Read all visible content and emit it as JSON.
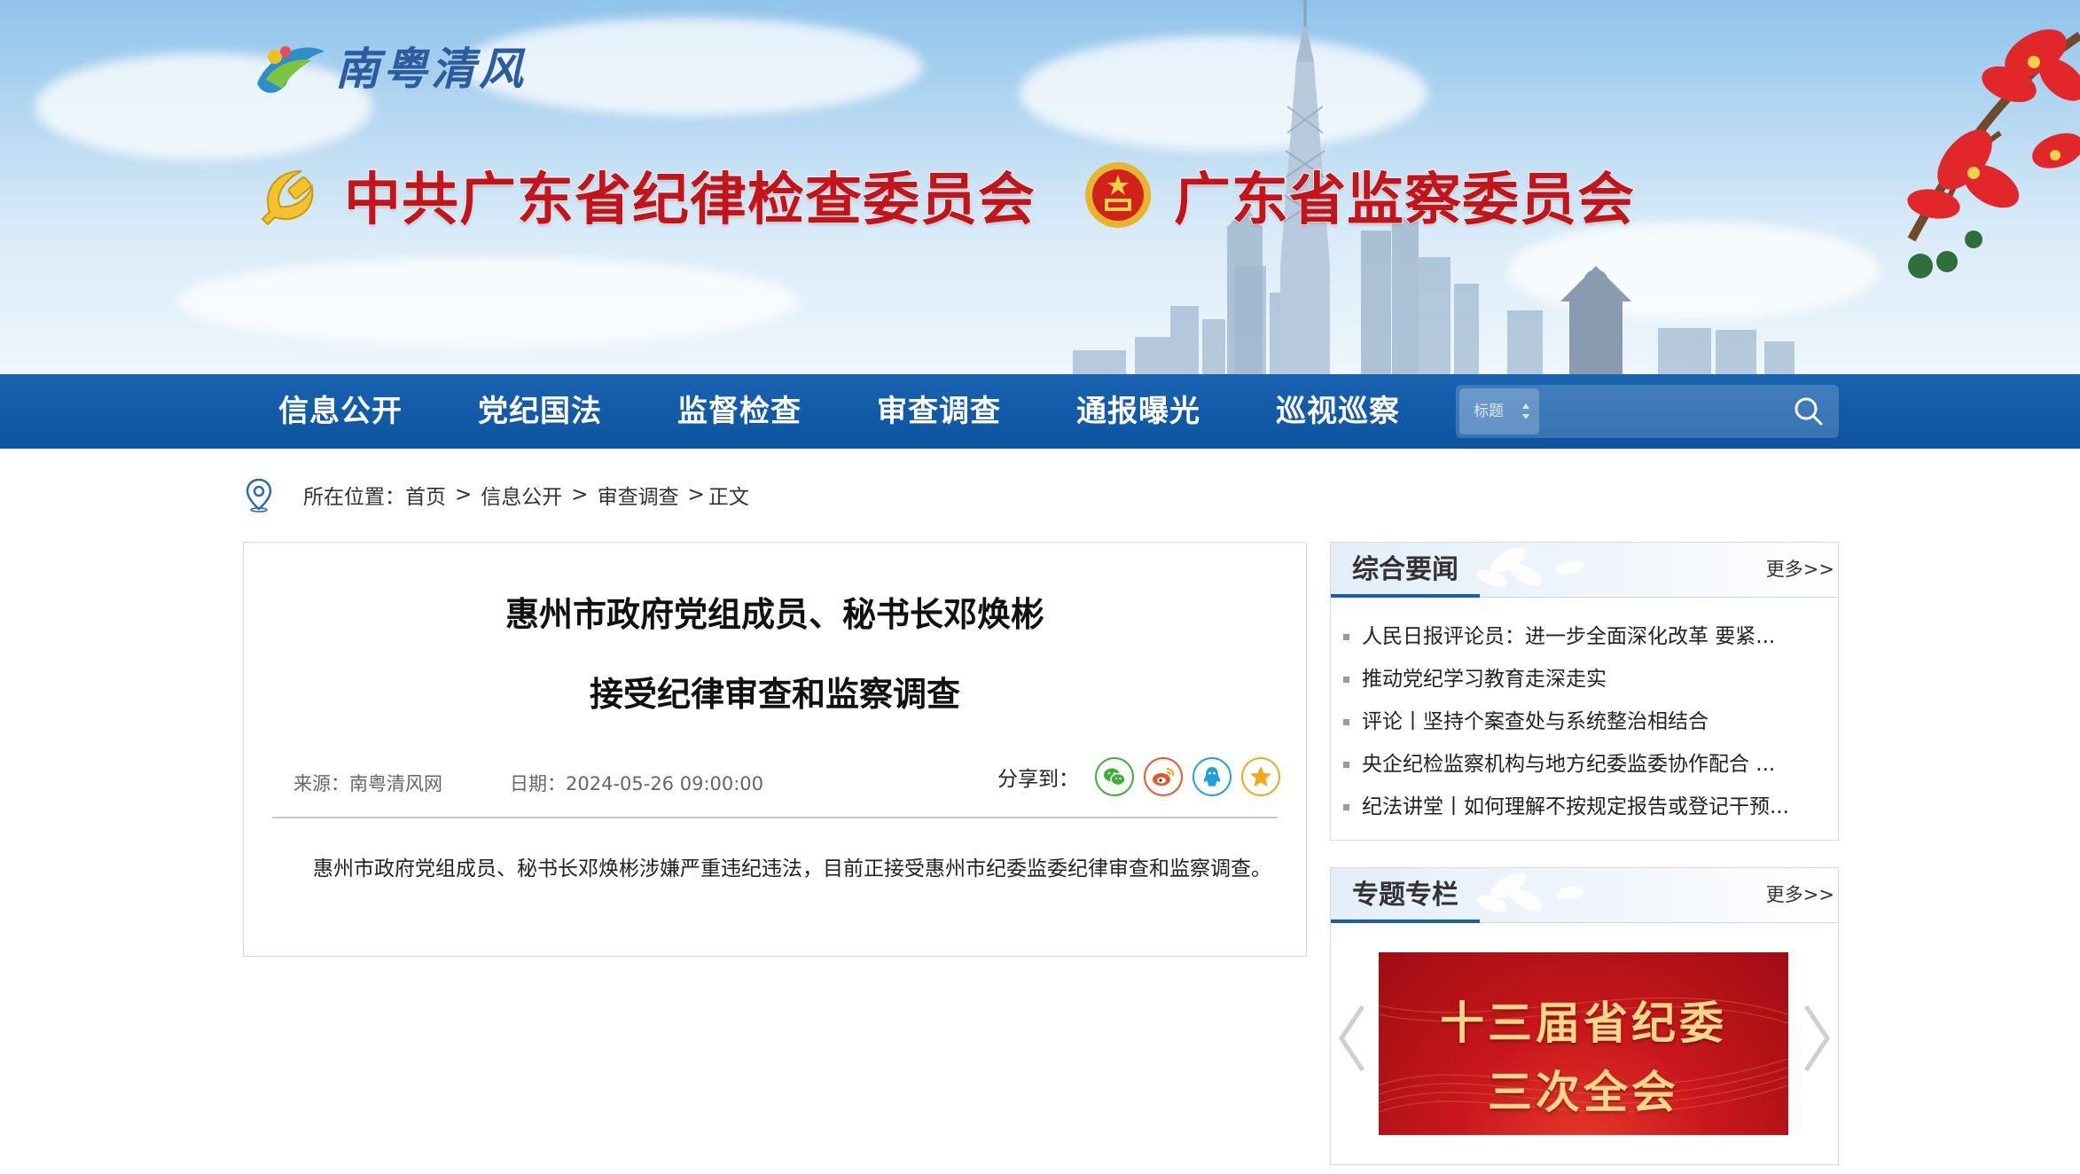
{
  "header": {
    "logo_text": "南粤清风",
    "title_party": "中共广东省纪律检查委员会",
    "title_state": "广东省监察委员会"
  },
  "nav": {
    "items": [
      {
        "label": "信息公开"
      },
      {
        "label": "党纪国法"
      },
      {
        "label": "监督检查"
      },
      {
        "label": "审查调查"
      },
      {
        "label": "通报曝光"
      },
      {
        "label": "巡视巡察"
      }
    ],
    "search": {
      "select_value": "标题",
      "input_value": "",
      "icon": "search-icon"
    }
  },
  "breadcrumb": {
    "prefix": "所在位置：",
    "items": [
      "首页",
      "信息公开",
      "审查调查"
    ],
    "separator": ">",
    "current": "正文"
  },
  "article": {
    "title_line1": "惠州市政府党组成员、秘书长邓焕彬",
    "title_line2": "接受纪律审查和监察调查",
    "source": "来源：南粤清风网",
    "date": "日期：2024-05-26 09:00:00",
    "share_label": "分享到：",
    "share_icons": [
      {
        "name": "wechat-icon",
        "color": "#3cb034"
      },
      {
        "name": "weibo-icon",
        "color": "#e6562a"
      },
      {
        "name": "qq-icon",
        "color": "#1e9fe0"
      },
      {
        "name": "qzone-icon",
        "color": "#f0a818"
      }
    ],
    "body": "惠州市政府党组成员、秘书长邓焕彬涉嫌严重违纪违法，目前正接受惠州市纪委监委纪律审查和监察调查。"
  },
  "sidebar": {
    "news": {
      "title": "综合要闻",
      "more": "更多>>",
      "items": [
        "人民日报评论员：进一步全面深化改革 要紧...",
        "推动党纪学习教育走深走实",
        "评论丨坚持个案查处与系统整治相结合",
        "央企纪检监察机构与地方纪委监委协作配合 ...",
        "纪法讲堂丨如何理解不按规定报告或登记干预..."
      ]
    },
    "topics": {
      "title": "专题专栏",
      "more": "更多>>",
      "banner_line1": "十三届省纪委",
      "banner_line2": "三次全会"
    }
  },
  "colors": {
    "nav_blue": "#0c53a0",
    "title_red": "#c4141b",
    "accent_blue": "#1a5ea8"
  }
}
